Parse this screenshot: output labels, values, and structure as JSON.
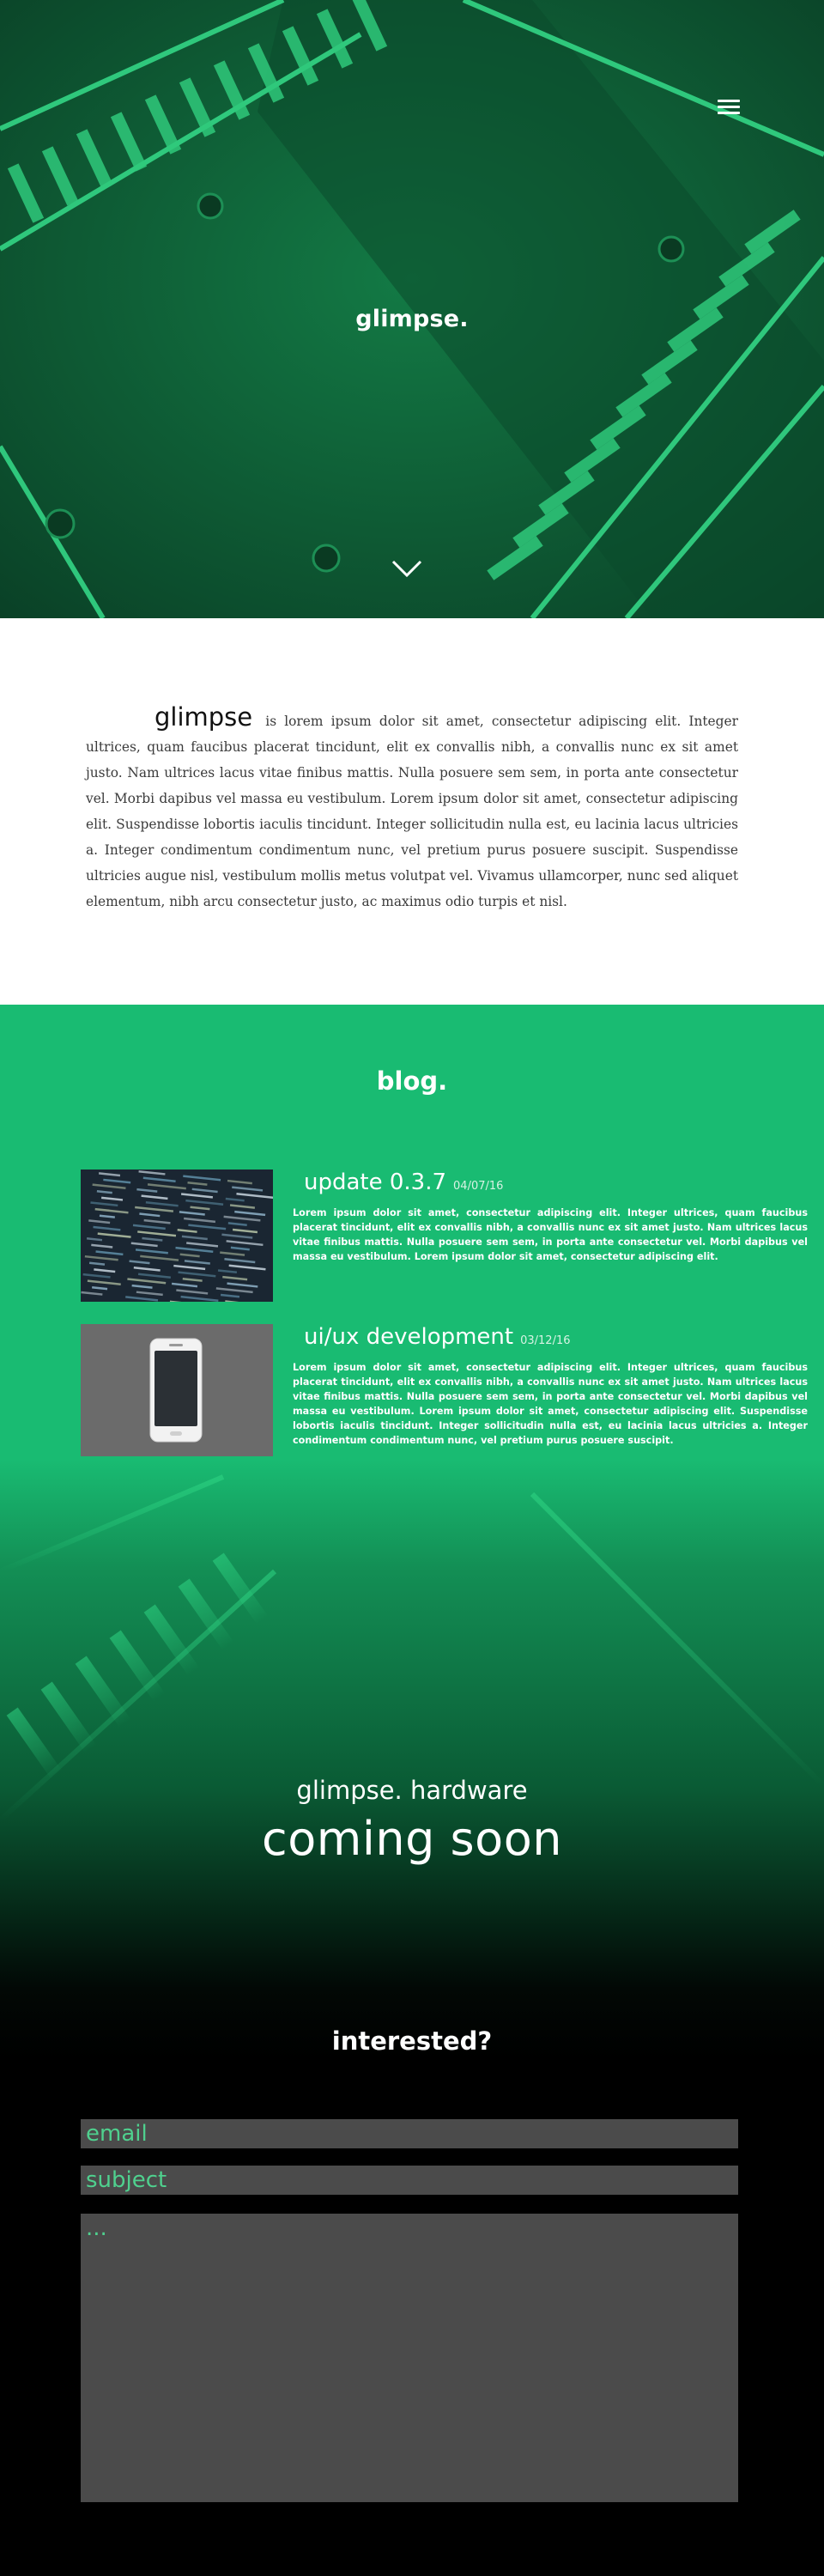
{
  "hero": {
    "title": "glimpse.",
    "menu_icon": "hamburger-menu-icon",
    "scroll_icon": "chevron-down-icon",
    "colors": {
      "tint": "#0e5a34",
      "stripe": "#2ad27f"
    }
  },
  "intro": {
    "brand": "glimpse",
    "text": "is lorem ipsum dolor sit amet, consectetur adipiscing elit. Integer ultrices, quam faucibus placerat tincidunt, elit ex convallis nibh, a convallis nunc ex sit amet justo. Nam ultrices lacus vitae finibus mattis. Nulla posuere sem sem, in porta ante consectetur vel. Morbi dapibus vel massa eu vestibulum. Lorem ipsum dolor sit amet, consectetur adipiscing elit. Suspendisse lobortis iaculis tincidunt. Integer sollicitudin nulla est, eu lacinia lacus ultricies a. Integer condimentum condimentum nunc, vel pretium purus posuere suscipit. Suspendisse ultricies augue nisl, vestibulum mollis metus volutpat vel. Vivamus ullamcorper, nunc sed aliquet elementum, nibh arcu consectetur justo, ac maximus odio turpis et nisl."
  },
  "blog": {
    "heading": "blog.",
    "accent": "#19bb72",
    "posts": [
      {
        "title": "update 0.3.7",
        "date": "04/07/16",
        "thumb_icon": "code-screen-thumbnail",
        "body": "Lorem ipsum dolor sit amet, consectetur adipiscing elit. Integer ultrices, quam faucibus placerat tincidunt, elit ex convallis nibh, a convallis nunc ex sit amet justo. Nam ultrices lacus vitae finibus mattis. Nulla posuere sem sem, in porta ante consectetur vel. Morbi dapibus vel massa eu vestibulum. Lorem ipsum dolor sit amet, consectetur adipiscing elit."
      },
      {
        "title": "ui/ux development",
        "date": "03/12/16",
        "thumb_icon": "smartphone-thumbnail",
        "body": "Lorem ipsum dolor sit amet, consectetur adipiscing elit. Integer ultrices, quam faucibus placerat tincidunt, elit ex convallis nibh, a convallis nunc ex sit amet justo. Nam ultrices lacus vitae finibus mattis. Nulla posuere sem sem, in porta ante consectetur vel. Morbi dapibus vel massa eu vestibulum. Lorem ipsum dolor sit amet, consectetur adipiscing elit. Suspendisse lobortis iaculis tincidunt. Integer sollicitudin nulla est, eu lacinia lacus ultricies a. Integer condimentum condimentum nunc, vel pretium purus posuere suscipit."
      }
    ]
  },
  "hardware": {
    "subtitle": "glimpse. hardware",
    "headline": "coming soon"
  },
  "contact": {
    "heading": "interested?",
    "email_placeholder": "email",
    "subject_placeholder": "subject",
    "message_placeholder": "...",
    "field_color": "#4b4b4b",
    "placeholder_color": "#4fd08e"
  }
}
